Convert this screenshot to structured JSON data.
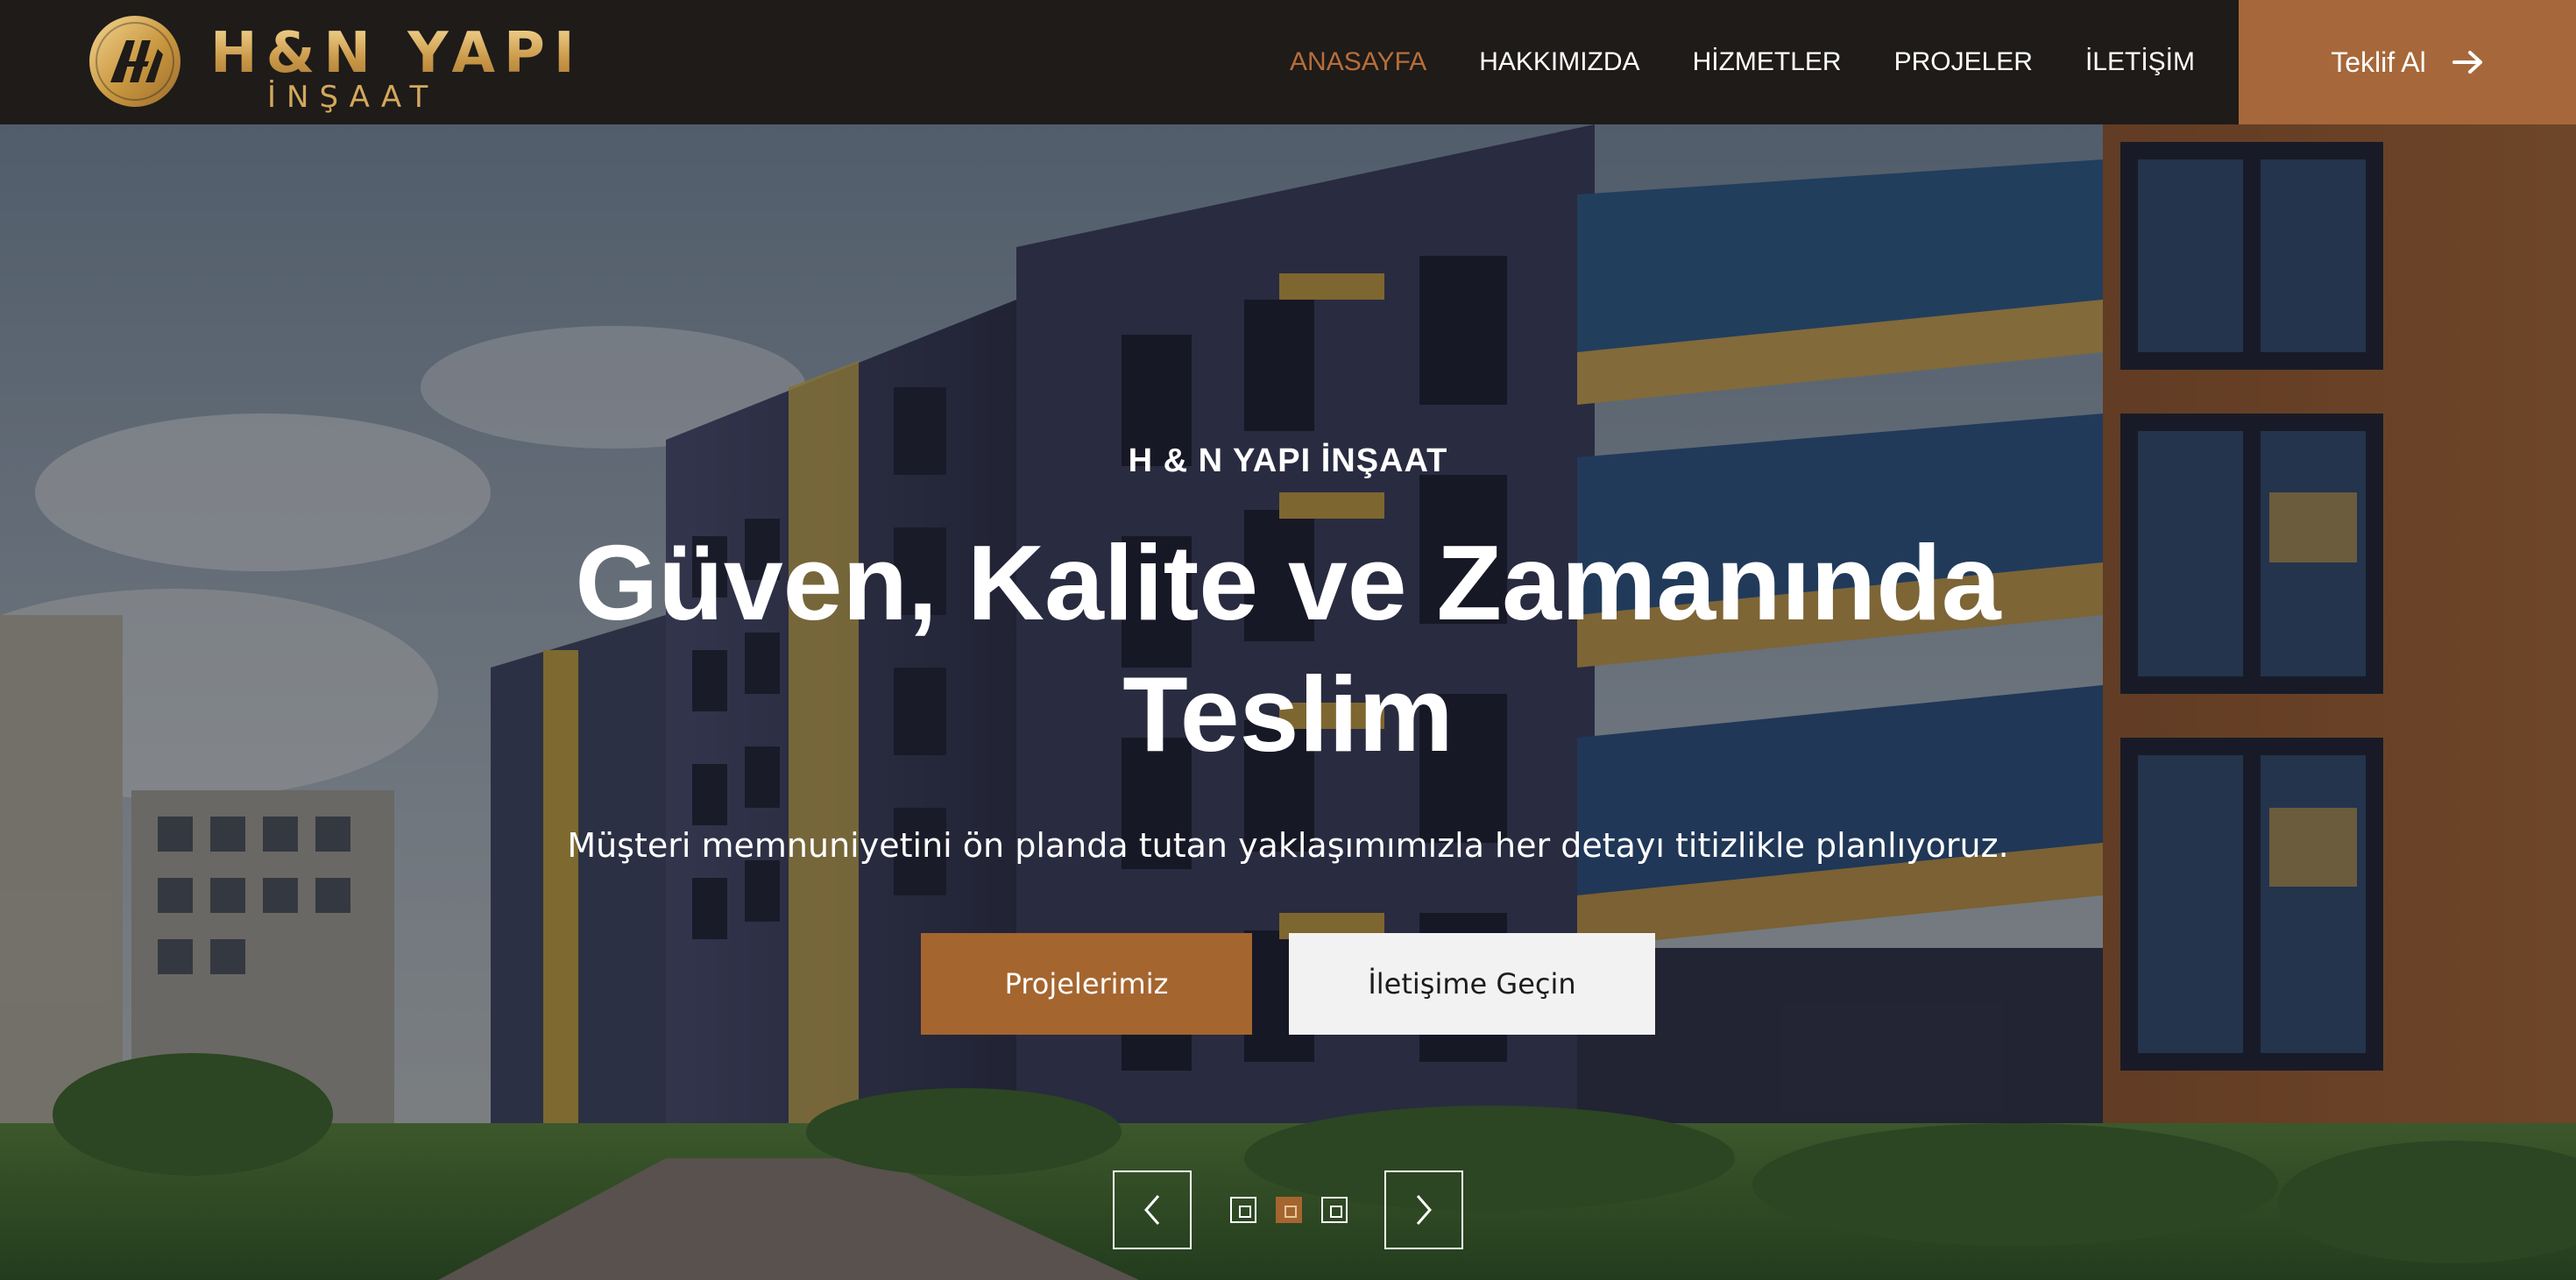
{
  "brand": {
    "name": "H&N YAPI",
    "subtitle": "İNŞAAT"
  },
  "nav": {
    "items": [
      {
        "label": "ANASAYFA",
        "active": true
      },
      {
        "label": "HAKKIMIZDA",
        "active": false
      },
      {
        "label": "HİZMETLER",
        "active": false
      },
      {
        "label": "PROJELER",
        "active": false
      },
      {
        "label": "İLETİŞİM",
        "active": false
      }
    ],
    "cta_label": "Teklif Al"
  },
  "hero": {
    "eyebrow": "H & N YAPI İNŞAAT",
    "headline": "Güven, Kalite ve Zamanında Teslim",
    "subtext": "Müşteri memnuniyetini ön planda tutan yaklaşımımızla her detayı titizlikle planlıyoruz.",
    "primary_button": "Projelerimiz",
    "secondary_button": "İletişime Geçin"
  },
  "slider": {
    "slide_count": 3,
    "active_index": 1
  },
  "colors": {
    "accent": "#a5652f",
    "nav_active": "#b76e3a",
    "navbar_bg": "#1e1b19",
    "logo_gold": "#d4a85c"
  },
  "icons": {
    "cta": "arrow-right-icon",
    "prev": "chevron-left-icon",
    "next": "chevron-right-icon"
  }
}
